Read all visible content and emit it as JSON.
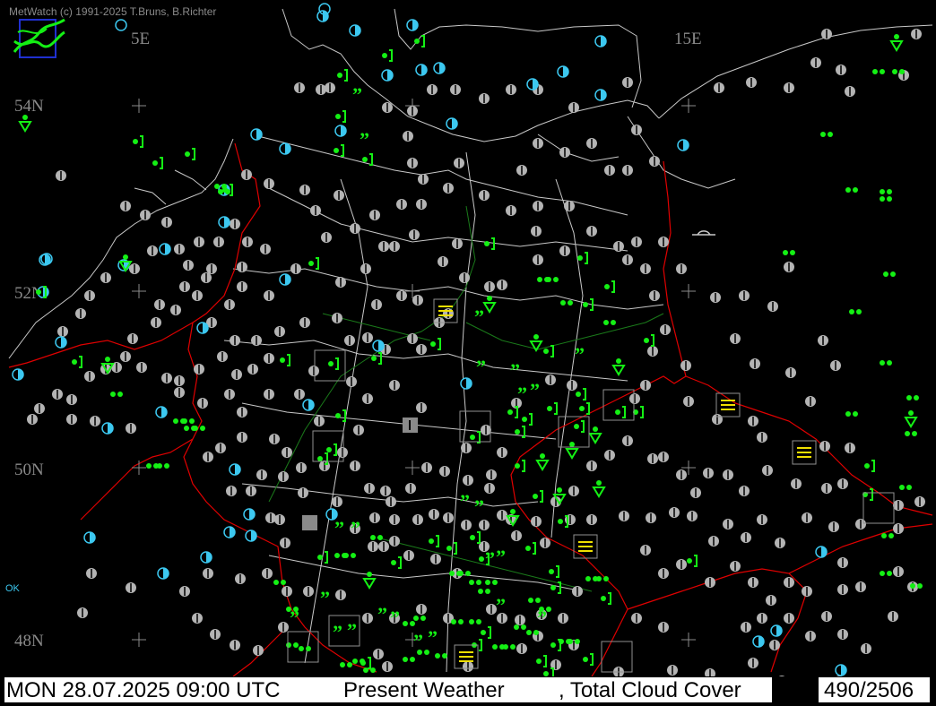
{
  "header": {
    "credit": "MetWatch  (c) 1991-2025 T.Bruns, B.Richter"
  },
  "map": {
    "lon_labels": [
      "5E",
      "15E"
    ],
    "lat_labels": [
      "54N",
      "52N",
      "50N",
      "48N"
    ],
    "edge_labels": [
      "OK"
    ],
    "colors": {
      "background": "#000000",
      "coast": "#c8c8c8",
      "border": "#e00000",
      "river": "#1a7a1a",
      "overcast": "#b4b4b4",
      "partly_cloudy": "#3cc8f0",
      "precipitation": "#14f014",
      "fog": "#f0e000"
    }
  },
  "status": {
    "datetime": "MON 28.07.2025 09:00 UTC",
    "product": "Present Weather",
    "secondary": ", Total Cloud Cover",
    "count": "490/2506"
  }
}
